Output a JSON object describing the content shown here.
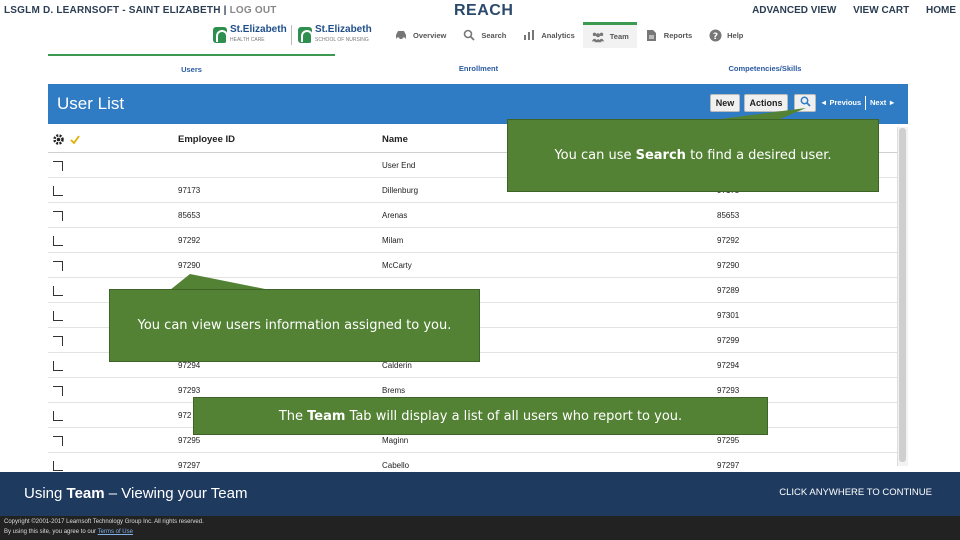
{
  "topbar": {
    "org_name": "LSGLM D. LEARNSOFT - SAINT ELIZABETH",
    "separator": "|",
    "logout": "LOG OUT",
    "brand": "REACH",
    "links": [
      "ADVANCED VIEW",
      "VIEW CART",
      "HOME"
    ]
  },
  "logos": [
    {
      "name": "St.Elizabeth",
      "tagline": "HEALTH CARE"
    },
    {
      "name": "St.Elizabeth",
      "tagline": "SCHOOL OF NURSING"
    }
  ],
  "nav": [
    {
      "label": "Overview",
      "icon": "car-icon",
      "active": false
    },
    {
      "label": "Search",
      "icon": "search-icon",
      "active": false
    },
    {
      "label": "Analytics",
      "icon": "bar-chart-icon",
      "active": false
    },
    {
      "label": "Team",
      "icon": "team-icon",
      "active": true
    },
    {
      "label": "Reports",
      "icon": "report-icon",
      "active": false
    },
    {
      "label": "Help",
      "icon": "help-icon",
      "active": false
    }
  ],
  "subtabs": [
    {
      "label": "Users",
      "active": true
    },
    {
      "label": "Enrollment",
      "active": false
    },
    {
      "label": "Competencies/Skills",
      "active": false
    }
  ],
  "user_list": {
    "title": "User List",
    "new_label": "New",
    "actions_label": "Actions",
    "previous_label": "◄ Previous",
    "next_label": "Next ►"
  },
  "table": {
    "columns": [
      "Employee ID",
      "Name"
    ],
    "rows": [
      {
        "id": "",
        "name": "User End",
        "id2": ""
      },
      {
        "id": "97173",
        "name": "Dillenburg",
        "id2": "97173"
      },
      {
        "id": "85653",
        "name": "Arenas",
        "id2": "85653"
      },
      {
        "id": "97292",
        "name": "Milam",
        "id2": "97292"
      },
      {
        "id": "97290",
        "name": "McCarty",
        "id2": "97290"
      },
      {
        "id": "",
        "name": "",
        "id2": "97289"
      },
      {
        "id": "",
        "name": "",
        "id2": "97301"
      },
      {
        "id": "",
        "name": "",
        "id2": "97299"
      },
      {
        "id": "97294",
        "name": "Calderin",
        "id2": "97294"
      },
      {
        "id": "97293",
        "name": "Brems",
        "id2": "97293"
      },
      {
        "id": "972",
        "name": "",
        "id2": ""
      },
      {
        "id": "97295",
        "name": "Maginn",
        "id2": "97295"
      },
      {
        "id": "97297",
        "name": "Cabello",
        "id2": "97297"
      }
    ]
  },
  "callouts": {
    "search": {
      "before": "You can use ",
      "bold": "Search",
      "after": " to find a desired user."
    },
    "users_info": {
      "text": "You can view users information assigned to you."
    },
    "team_tab": {
      "before": "The ",
      "bold": "Team",
      "after": " Tab will display a list of all users who report to you."
    }
  },
  "footer": {
    "title_before": "Using ",
    "title_bold": "Team",
    "title_after": " – Viewing your Team",
    "continue": "CLICK ANYWHERE TO CONTINUE",
    "copyright": "Copyright ©2001-2017 Learnsoft Technology Group Inc. All rights reserved.",
    "terms_prefix": "By using this site, you agree to our",
    "terms_link": "Terms of Use"
  },
  "colors": {
    "header_blue": "#2f7bc4",
    "callout_green": "#548235",
    "active_green": "#3b9a4f",
    "footer_navy": "#1f3a5f"
  }
}
